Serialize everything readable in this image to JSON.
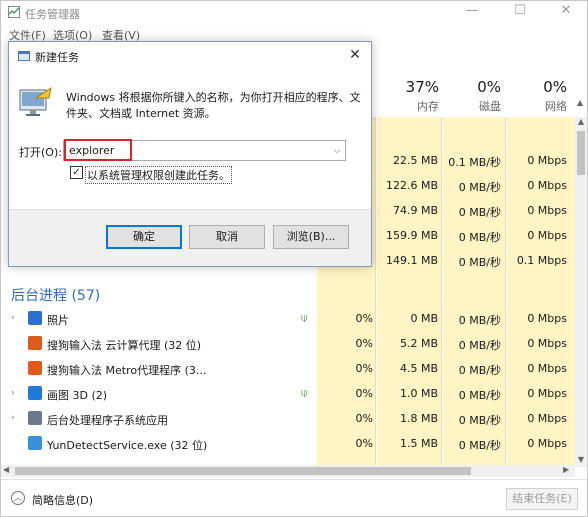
{
  "window": {
    "title": "任务管理器",
    "controls": {
      "minimize": "—",
      "maximize": "☐",
      "close": "✕"
    }
  },
  "menu": {
    "file": "文件(F)",
    "options": "选项(O)",
    "view": "查看(V)"
  },
  "columns": {
    "memory": {
      "pct": "37%",
      "label": "内存"
    },
    "disk": {
      "pct": "0%",
      "label": "磁盘"
    },
    "network": {
      "pct": "0%",
      "label": "网络"
    }
  },
  "app_rows": [
    {
      "mem": "22.5 MB",
      "disk": "0.1 MB/秒",
      "net": "0 Mbps"
    },
    {
      "mem": "122.6 MB",
      "disk": "0 MB/秒",
      "net": "0 Mbps"
    },
    {
      "mem": "74.9 MB",
      "disk": "0 MB/秒",
      "net": "0 Mbps"
    },
    {
      "mem": "159.9 MB",
      "disk": "0 MB/秒",
      "net": "0 Mbps"
    },
    {
      "mem": "149.1 MB",
      "disk": "0 MB/秒",
      "net": "0.1 Mbps"
    }
  ],
  "background_heading": "后台进程 (57)",
  "processes": [
    {
      "name": "照片",
      "cpu": "0%",
      "mem": "0 MB",
      "disk": "0 MB/秒",
      "net": "0 Mbps",
      "expand": "›",
      "leaf": true,
      "icon": "photos-icon",
      "color": "#2a6fcf"
    },
    {
      "name": "搜狗输入法 云计算代理 (32 位)",
      "cpu": "0%",
      "mem": "5.2 MB",
      "disk": "0 MB/秒",
      "net": "0 Mbps",
      "expand": "",
      "leaf": false,
      "icon": "sogou-icon",
      "color": "#e05a1c"
    },
    {
      "name": "搜狗输入法 Metro代理程序 (3...",
      "cpu": "0%",
      "mem": "4.5 MB",
      "disk": "0 MB/秒",
      "net": "0 Mbps",
      "expand": "",
      "leaf": false,
      "icon": "sogou-icon",
      "color": "#e05a1c"
    },
    {
      "name": "画图 3D (2)",
      "cpu": "0%",
      "mem": "1.0 MB",
      "disk": "0 MB/秒",
      "net": "0 Mbps",
      "expand": "›",
      "leaf": true,
      "icon": "paint3d-icon",
      "color": "#1f7ae0"
    },
    {
      "name": "后台处理程序子系统应用",
      "cpu": "0%",
      "mem": "1.8 MB",
      "disk": "0 MB/秒",
      "net": "0 Mbps",
      "expand": "›",
      "leaf": false,
      "icon": "printer-icon",
      "color": "#6a7a8c"
    },
    {
      "name": "YunDetectService.exe (32 位)",
      "cpu": "0%",
      "mem": "1.5 MB",
      "disk": "0 MB/秒",
      "net": "0 Mbps",
      "expand": "",
      "leaf": false,
      "icon": "cloud-icon",
      "color": "#3b8fd9"
    }
  ],
  "footer": {
    "fewer_details": "简略信息(D)",
    "end_task": "结束任务(E)"
  },
  "dialog": {
    "title": "新建任务",
    "close": "✕",
    "description": "Windows 将根据你所键入的名称，为你打开相应的程序、文件夹、文档或 Internet 资源。",
    "open_label": "打开(O):",
    "open_value": "explorer",
    "admin_checked": "✓",
    "admin_label": "以系统管理权限创建此任务。",
    "ok": "确定",
    "cancel": "取消",
    "browse": "浏览(B)..."
  },
  "colors": {
    "highlight": "#d9262a",
    "accent": "#0078d7",
    "column_bg": "#fff4c4",
    "heading": "#2a6eb8"
  }
}
